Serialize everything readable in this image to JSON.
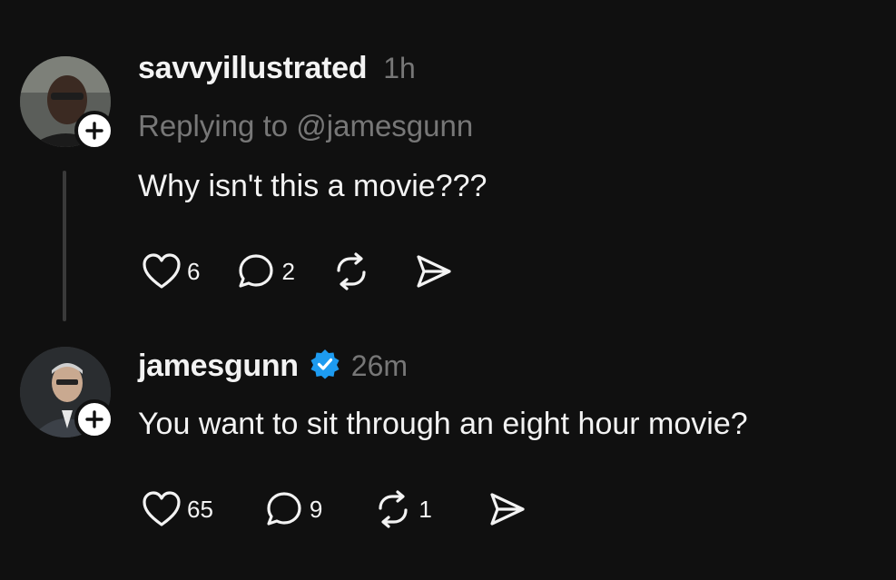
{
  "posts": [
    {
      "username": "savvyillustrated",
      "time": "1h",
      "replying_to": "Replying to @jamesgunn",
      "text": "Why isn't this a movie???",
      "likes": "6",
      "replies": "2",
      "reposts": "",
      "verified": false
    },
    {
      "username": "jamesgunn",
      "time": "26m",
      "text": "You want to sit through an eight hour movie?",
      "likes": "65",
      "replies": "9",
      "reposts": "1",
      "verified": true
    }
  ],
  "colors": {
    "background": "#101010",
    "text": "#f3f3f3",
    "muted": "#777777",
    "verified": "#1d9bf0",
    "thread_line": "#3a3a3a"
  }
}
